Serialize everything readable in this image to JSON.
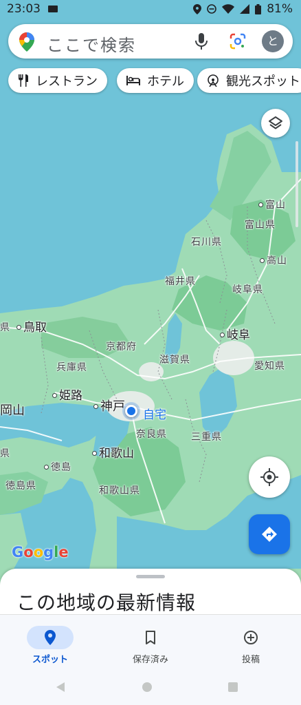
{
  "status_bar": {
    "time": "23:03",
    "battery": "81%"
  },
  "search": {
    "placeholder": "ここで検索",
    "avatar_initial": "と"
  },
  "chips": [
    {
      "label": "レストラン",
      "icon": "restaurant-icon"
    },
    {
      "label": "ホテル",
      "icon": "hotel-icon"
    },
    {
      "label": "観光スポット",
      "icon": "attraction-icon"
    }
  ],
  "map": {
    "labels": {
      "toyama": "富山",
      "toyama_pref": "富山県",
      "ishikawa": "石川県",
      "takayama": "高山",
      "fukui": "福井県",
      "gifu_pref": "岐阜県",
      "tottori": "鳥取",
      "gifu": "岐阜",
      "kyoto": "京都府",
      "hyogo": "兵庫県",
      "shiga": "滋賀県",
      "aichi": "愛知県",
      "himeji": "姫路",
      "kobe": "神戸",
      "okayama": "岡山",
      "home": "自宅",
      "nara": "奈良県",
      "mie": "三重県",
      "ken": "県",
      "wakayama": "和歌山",
      "tokushima": "徳島",
      "tokushima_pref": "徳島県",
      "wakayama_pref": "和歌山県"
    },
    "attribution": "Google",
    "colors": {
      "water": "#6fc3d8",
      "land": "#9fdbb5",
      "forest": "#7ccb96",
      "urban": "#e4ece7",
      "road": "#ffffff",
      "accent": "#1a73e8"
    }
  },
  "sheet": {
    "title": "この地域の最新情報"
  },
  "bottom_nav": [
    {
      "label": "スポット",
      "icon": "location-pin-icon",
      "active": true
    },
    {
      "label": "保存済み",
      "icon": "bookmark-icon",
      "active": false
    },
    {
      "label": "投稿",
      "icon": "add-circle-icon",
      "active": false
    }
  ]
}
